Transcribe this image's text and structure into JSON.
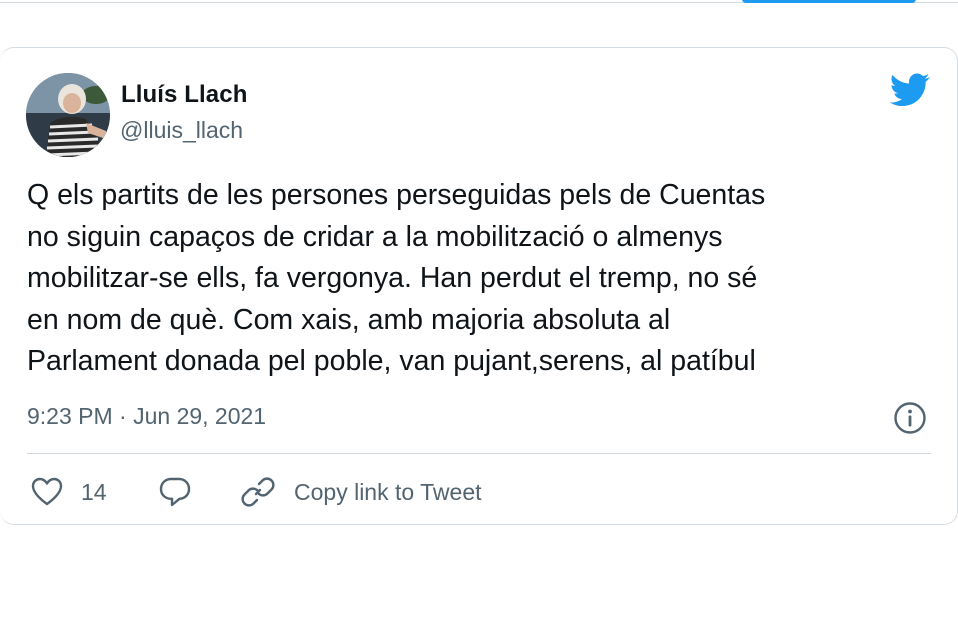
{
  "tweet": {
    "author": {
      "name": "Lluís Llach",
      "handle": "@lluis_llach"
    },
    "text": "Q els partits de les persones perseguidas pels de Cuentas\nno siguin capaços de cridar a la mobilització o almenys\nmobilitzar-se ells, fa vergonya. Han perdut el tremp, no sé\nen nom de què. Com xais, amb majoria absoluta al\nParlament donada pel poble, van pujant,serens, al patíbul",
    "timestamp": "9:23 PM · Jun 29, 2021",
    "likes": "14",
    "copy_link_label": "Copy link to Tweet"
  },
  "icons": {
    "brand": "twitter-bird-icon",
    "info": "info-icon",
    "like": "heart-icon",
    "reply": "reply-bubble-icon",
    "copy": "link-icon"
  },
  "colors": {
    "brand_blue": "#1d9bf0",
    "text_primary": "#0f1419",
    "text_secondary": "#536471",
    "border": "#cfd9de"
  }
}
